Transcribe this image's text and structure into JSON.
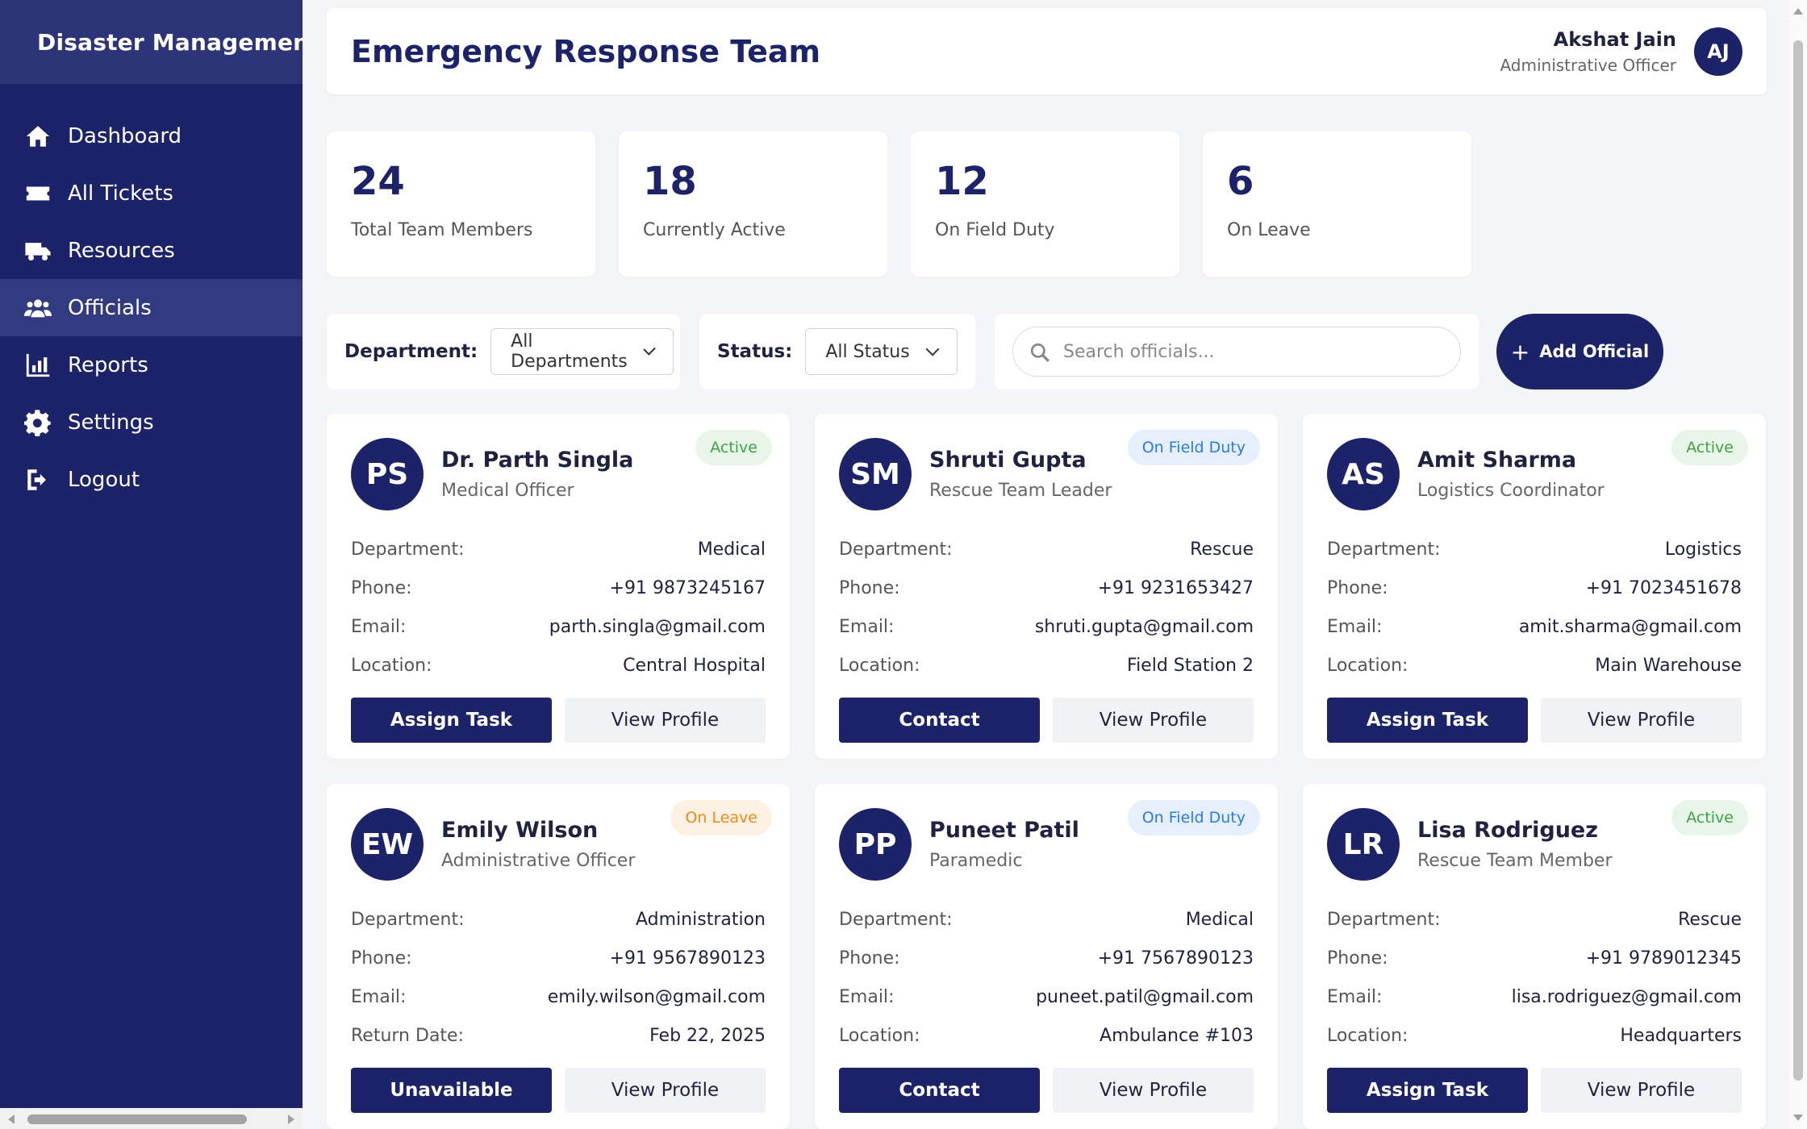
{
  "sidebar": {
    "brand": "Disaster Management",
    "items": [
      {
        "label": "Dashboard",
        "icon": "home-icon"
      },
      {
        "label": "All Tickets",
        "icon": "ticket-icon"
      },
      {
        "label": "Resources",
        "icon": "truck-icon"
      },
      {
        "label": "Officials",
        "icon": "users-icon",
        "active": true
      },
      {
        "label": "Reports",
        "icon": "chart-icon"
      },
      {
        "label": "Settings",
        "icon": "gear-icon"
      },
      {
        "label": "Logout",
        "icon": "logout-icon"
      }
    ]
  },
  "header": {
    "title": "Emergency Response Team",
    "user_name": "Akshat Jain",
    "user_role": "Administrative Officer",
    "user_initials": "AJ"
  },
  "stats": [
    {
      "value": "24",
      "label": "Total Team Members"
    },
    {
      "value": "18",
      "label": "Currently Active"
    },
    {
      "value": "12",
      "label": "On Field Duty"
    },
    {
      "value": "6",
      "label": "On Leave"
    }
  ],
  "filters": {
    "department_label": "Department:",
    "department_value": "All Departments",
    "status_label": "Status:",
    "status_value": "All Status",
    "search_placeholder": "Search officials...",
    "add_button": "Add Official"
  },
  "cards": [
    {
      "initials": "PS",
      "name": "Dr. Parth Singla",
      "role": "Medical Officer",
      "status": "Active",
      "status_type": "active",
      "rows": [
        {
          "k": "Department:",
          "v": "Medical"
        },
        {
          "k": "Phone:",
          "v": "+91 9873245167"
        },
        {
          "k": "Email:",
          "v": "parth.singla@gmail.com"
        },
        {
          "k": "Location:",
          "v": "Central Hospital"
        }
      ],
      "primary": "Assign Task",
      "secondary": "View Profile"
    },
    {
      "initials": "SM",
      "name": "Shruti Gupta",
      "role": "Rescue Team Leader",
      "status": "On Field Duty",
      "status_type": "field",
      "rows": [
        {
          "k": "Department:",
          "v": "Rescue"
        },
        {
          "k": "Phone:",
          "v": "+91 9231653427"
        },
        {
          "k": "Email:",
          "v": "shruti.gupta@gmail.com"
        },
        {
          "k": "Location:",
          "v": "Field Station 2"
        }
      ],
      "primary": "Contact",
      "secondary": "View Profile"
    },
    {
      "initials": "AS",
      "name": "Amit Sharma",
      "role": "Logistics Coordinator",
      "status": "Active",
      "status_type": "active",
      "rows": [
        {
          "k": "Department:",
          "v": "Logistics"
        },
        {
          "k": "Phone:",
          "v": "+91 7023451678"
        },
        {
          "k": "Email:",
          "v": "amit.sharma@gmail.com"
        },
        {
          "k": "Location:",
          "v": "Main Warehouse"
        }
      ],
      "primary": "Assign Task",
      "secondary": "View Profile"
    },
    {
      "initials": "EW",
      "name": "Emily Wilson",
      "role": "Administrative Officer",
      "status": "On Leave",
      "status_type": "leave",
      "rows": [
        {
          "k": "Department:",
          "v": "Administration"
        },
        {
          "k": "Phone:",
          "v": "+91 9567890123"
        },
        {
          "k": "Email:",
          "v": "emily.wilson@gmail.com"
        },
        {
          "k": "Return Date:",
          "v": "Feb 22, 2025"
        }
      ],
      "primary": "Unavailable",
      "secondary": "View Profile"
    },
    {
      "initials": "PP",
      "name": "Puneet Patil",
      "role": "Paramedic",
      "status": "On Field Duty",
      "status_type": "field",
      "rows": [
        {
          "k": "Department:",
          "v": "Medical"
        },
        {
          "k": "Phone:",
          "v": "+91 7567890123"
        },
        {
          "k": "Email:",
          "v": "puneet.patil@gmail.com"
        },
        {
          "k": "Location:",
          "v": "Ambulance #103"
        }
      ],
      "primary": "Contact",
      "secondary": "View Profile"
    },
    {
      "initials": "LR",
      "name": "Lisa Rodriguez",
      "role": "Rescue Team Member",
      "status": "Active",
      "status_type": "active",
      "rows": [
        {
          "k": "Department:",
          "v": "Rescue"
        },
        {
          "k": "Phone:",
          "v": "+91 9789012345"
        },
        {
          "k": "Email:",
          "v": "lisa.rodriguez@gmail.com"
        },
        {
          "k": "Location:",
          "v": "Headquarters"
        }
      ],
      "primary": "Assign Task",
      "secondary": "View Profile"
    }
  ],
  "colors": {
    "primary": "#1c2369",
    "active": "#3fa146",
    "field": "#2c7be5",
    "leave": "#ef8a1a"
  }
}
